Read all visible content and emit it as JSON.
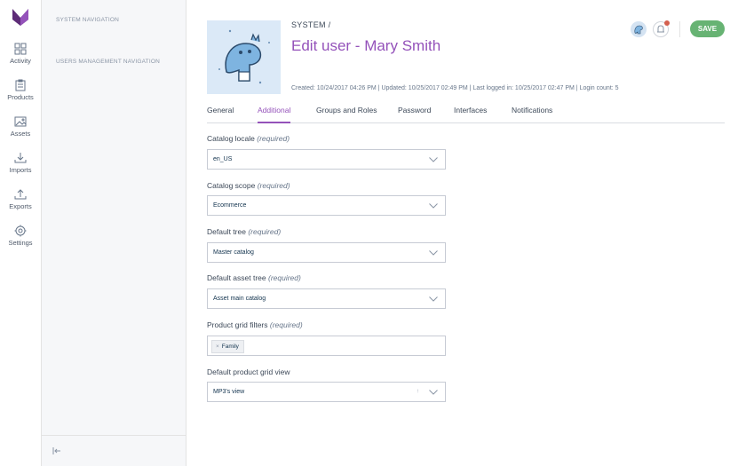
{
  "menu": {
    "items": [
      {
        "label": "Activity",
        "icon": "dashboard-grid-icon"
      },
      {
        "label": "Products",
        "icon": "clipboard-icon"
      },
      {
        "label": "Assets",
        "icon": "image-icon"
      },
      {
        "label": "Imports",
        "icon": "download-icon"
      },
      {
        "label": "Exports",
        "icon": "upload-icon"
      },
      {
        "label": "Settings",
        "icon": "gear-icon"
      }
    ]
  },
  "subnav": {
    "system_navigation": "SYSTEM NAVIGATION",
    "users_management_navigation": "USERS MANAGEMENT NAVIGATION"
  },
  "header": {
    "breadcrumb": "SYSTEM /",
    "title": "Edit user - Mary Smith",
    "meta": "Created: 10/24/2017 04:26 PM | Updated: 10/25/2017 02:49 PM | Last logged in: 10/25/2017 02:47 PM | Login count: 5",
    "save_label": "SAVE"
  },
  "tabs": [
    {
      "label": "General",
      "active": false
    },
    {
      "label": "Additional",
      "active": true
    },
    {
      "label": "Groups and Roles",
      "active": false
    },
    {
      "label": "Password",
      "active": false
    },
    {
      "label": "Interfaces",
      "active": false
    },
    {
      "label": "Notifications",
      "active": false
    }
  ],
  "fields": {
    "catalog_locale": {
      "label": "Catalog locale",
      "required": "(required)",
      "value": "en_US"
    },
    "catalog_scope": {
      "label": "Catalog scope",
      "required": "(required)",
      "value": "Ecommerce"
    },
    "default_tree": {
      "label": "Default tree",
      "required": "(required)",
      "value": "Master catalog"
    },
    "default_asset_tree": {
      "label": "Default asset tree",
      "required": "(required)",
      "value": "Asset main catalog"
    },
    "product_grid_filters": {
      "label": "Product grid filters",
      "required": "(required)",
      "tags": [
        "Family"
      ],
      "remove_glyph": "×"
    },
    "default_product_grid_view": {
      "label": "Default product grid view",
      "value": "MP3's view",
      "clear_mark": "ᵎ"
    }
  },
  "colors": {
    "accent": "#9452ba",
    "save": "#67b373",
    "notification": "#d4604f"
  }
}
